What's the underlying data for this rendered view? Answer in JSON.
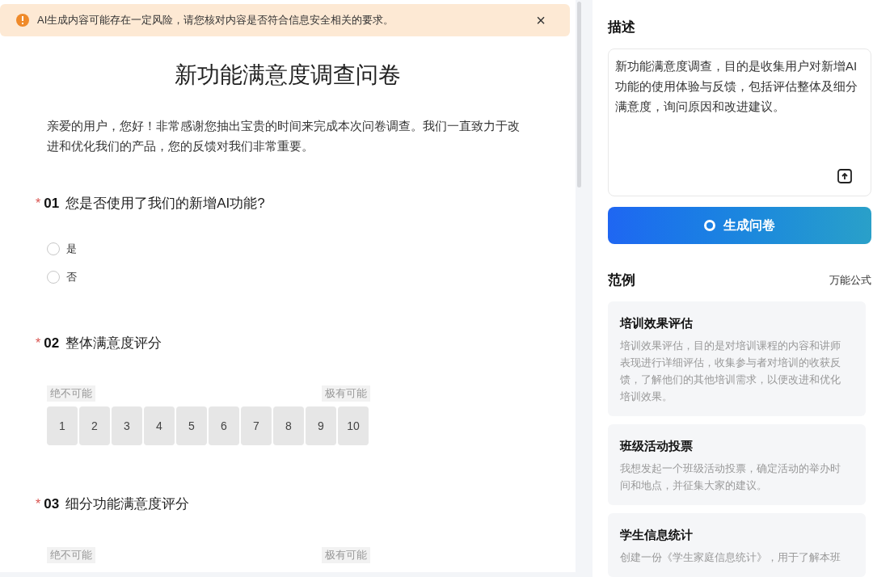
{
  "banner": {
    "text": "AI生成内容可能存在一定风险，请您核对内容是否符合信息安全相关的要求。",
    "close": "×"
  },
  "survey": {
    "title": "新功能满意度调查问卷",
    "intro": "亲爱的用户，您好！非常感谢您抽出宝贵的时间来完成本次问卷调查。我们一直致力于改进和优化我们的产品，您的反馈对我们非常重要。",
    "questions": [
      {
        "kind": "choice",
        "required_mark": "*",
        "number": "01",
        "text": "您是否使用了我们的新增AI功能?",
        "options": [
          {
            "label": "是",
            "selected": false
          },
          {
            "label": "否",
            "selected": false
          }
        ]
      },
      {
        "kind": "scale",
        "required_mark": "*",
        "number": "02",
        "text": "整体满意度评分",
        "low": "绝不可能",
        "high": "极有可能",
        "scores": [
          "1",
          "2",
          "3",
          "4",
          "5",
          "6",
          "7",
          "8",
          "9",
          "10"
        ]
      },
      {
        "kind": "scale",
        "required_mark": "*",
        "number": "03",
        "text": "细分功能满意度评分",
        "low": "绝不可能",
        "high": "极有可能"
      }
    ]
  },
  "sidebar": {
    "description_label": "描述",
    "description": "新功能满意度调查，目的是收集用户对新增AI功能的使用体验与反馈，包括评估整体及细分满意度，询问原因和改进建议。",
    "generate_button": "生成问卷",
    "examples_label": "范例",
    "formula_link": "万能公式",
    "examples": [
      {
        "title": "培训效果评估",
        "text": "培训效果评估，目的是对培训课程的内容和讲师表现进行详细评估，收集参与者对培训的收获反馈，了解他们的其他培训需求，以便改进和优化培训效果。"
      },
      {
        "title": "班级活动投票",
        "text": "我想发起一个班级活动投票，确定活动的举办时间和地点，并征集大家的建议。"
      },
      {
        "title": "学生信息统计",
        "text": "创建一份《学生家庭信息统计》，用于了解本班"
      }
    ]
  }
}
